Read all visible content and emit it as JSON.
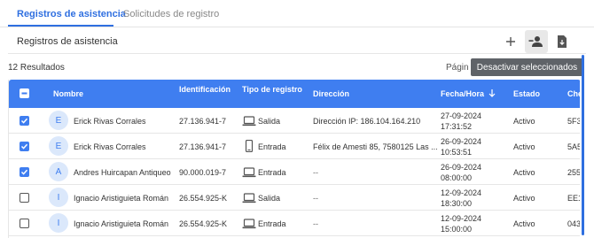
{
  "tabs": [
    "Registros de asistencia",
    "Solicitudes de registro"
  ],
  "panel": {
    "title": "Registros de asistencia"
  },
  "toolbar": {
    "add_icon": "plus-icon",
    "deactivate_icon": "person-remove-icon",
    "export_icon": "file-download-icon"
  },
  "tooltip": "Desactivar seleccionados",
  "results_label": "12 Resultados",
  "pagination_label": "Págin",
  "colors": {
    "primary": "#3f7ef0",
    "tab_active": "#2f6fe0",
    "tooltip_bg": "#5f6368"
  },
  "table": {
    "headers": [
      "Nombre",
      "Identificación",
      "Tipo de registro",
      "Dirección",
      "Fecha/Hora",
      "Estado",
      "Che"
    ],
    "rows": [
      {
        "checked": true,
        "initial": "E",
        "name": "Erick Rivas Corrales",
        "id": "27.136.941-7",
        "type": "Salida",
        "device": "laptop-icon",
        "address": "Dirección IP: 186.104.164.210",
        "date": "27-09-2024",
        "time": "17:31:52",
        "status": "Activo",
        "check": "5F3"
      },
      {
        "checked": true,
        "initial": "E",
        "name": "Erick Rivas Corrales",
        "id": "27.136.941-7",
        "type": "Entrada",
        "device": "phone-icon",
        "address": "Félix de Amesti 85, 7580125 Las ...",
        "date": "26-09-2024",
        "time": "10:53:51",
        "status": "Activo",
        "check": "5A5"
      },
      {
        "checked": true,
        "initial": "A",
        "name": "Andres Huircapan Antiqueo",
        "id": "90.000.019-7",
        "type": "Entrada",
        "device": "laptop-icon",
        "address": "--",
        "date": "26-09-2024",
        "time": "08:00:00",
        "status": "Activo",
        "check": "255"
      },
      {
        "checked": false,
        "initial": "I",
        "name": "Ignacio Aristiguieta Román",
        "id": "26.554.925-K",
        "type": "Salida",
        "device": "laptop-icon",
        "address": "--",
        "date": "12-09-2024",
        "time": "18:30:00",
        "status": "Activo",
        "check": "EE1"
      },
      {
        "checked": false,
        "initial": "I",
        "name": "Ignacio Aristiguieta Román",
        "id": "26.554.925-K",
        "type": "Entrada",
        "device": "laptop-icon",
        "address": "--",
        "date": "12-09-2024",
        "time": "15:00:00",
        "status": "Activo",
        "check": "043"
      }
    ]
  }
}
